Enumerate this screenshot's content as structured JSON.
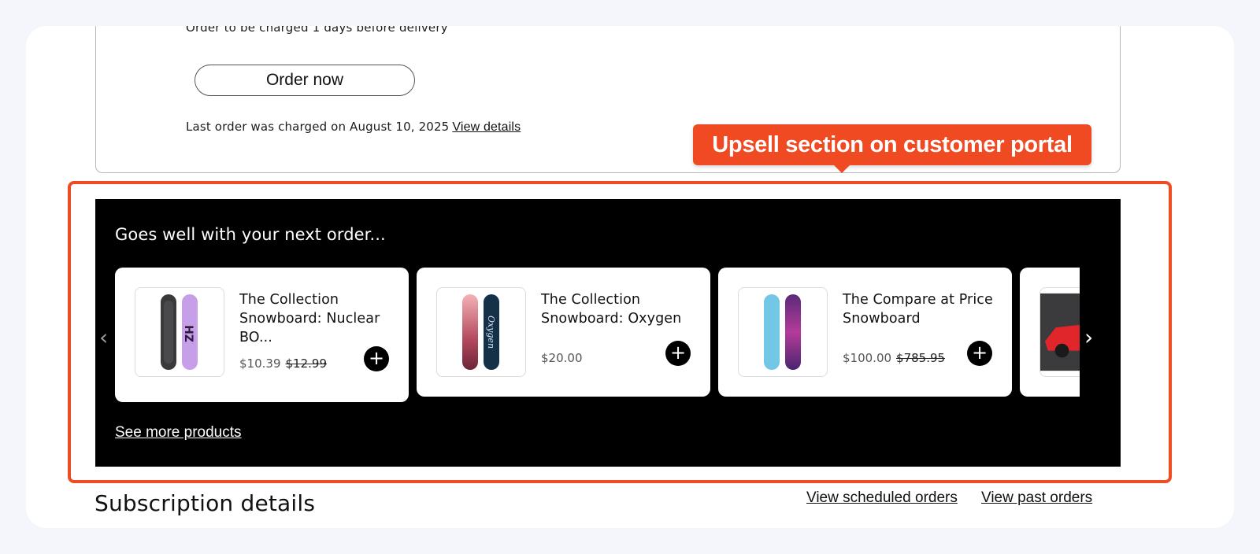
{
  "order_card": {
    "charge_note": "Order to be charged 1 days before delivery",
    "order_button": "Order now",
    "last_order_text": "Last order was charged on August 10, 2025",
    "view_details": "View details"
  },
  "callout": {
    "text": "Upsell section on customer portal",
    "color": "#f04a23"
  },
  "upsell": {
    "title": "Goes well with your next order...",
    "prev_icon": "chevron-left-icon",
    "next_icon": "chevron-right-icon",
    "products": [
      {
        "name": "The Collection Snowboard: Nuclear BO...",
        "price": "$10.39",
        "compare_price": "$12.99"
      },
      {
        "name": "The Collection Snowboard: Oxygen",
        "price": "$20.00",
        "compare_price": ""
      },
      {
        "name": "The Compare at Price Snowboard",
        "price": "$100.00",
        "compare_price": "$785.95"
      }
    ],
    "add_icon": "plus-icon",
    "see_more": "See more products"
  },
  "footer": {
    "subscription_title": "Subscription details",
    "view_scheduled": "View scheduled orders",
    "view_past": "View past orders"
  }
}
